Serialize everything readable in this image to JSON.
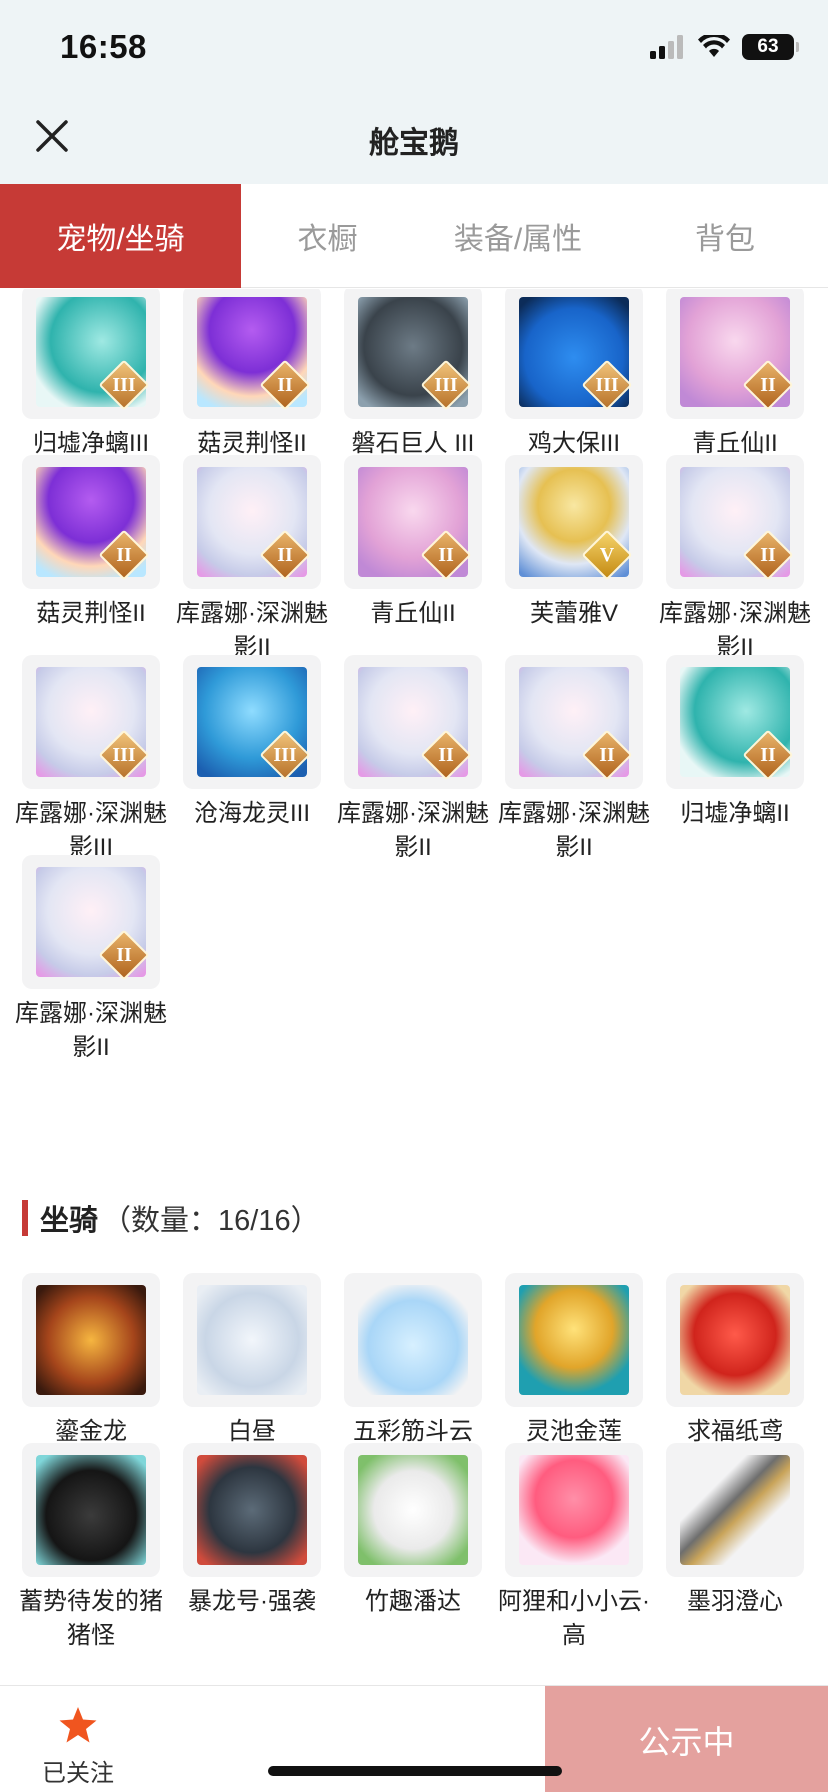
{
  "status": {
    "time": "16:58",
    "battery": "63"
  },
  "nav": {
    "title": "舱宝鹅"
  },
  "tabs": [
    {
      "label": "宠物/坐骑",
      "active": true
    },
    {
      "label": "衣橱",
      "active": false
    },
    {
      "label": "装备/属性",
      "active": false
    },
    {
      "label": "背包",
      "active": false
    }
  ],
  "pets": [
    {
      "name": "归墟净螭III",
      "rank": "III",
      "icon": "teal-dragon"
    },
    {
      "name": "菇灵荆怪II",
      "rank": "II",
      "icon": "purple-mushroom-child"
    },
    {
      "name": "磐石巨人 III",
      "rank": "III",
      "icon": "stone-golem"
    },
    {
      "name": "鸡大保III",
      "rank": "III",
      "icon": "blue-bird"
    },
    {
      "name": "青丘仙II",
      "rank": "II",
      "icon": "fox-fairy"
    },
    {
      "name": "菇灵荆怪II",
      "rank": "II",
      "icon": "purple-mushroom-child"
    },
    {
      "name": "库露娜·深渊魅影II",
      "rank": "II",
      "icon": "white-haired-spirit"
    },
    {
      "name": "青丘仙II",
      "rank": "II",
      "icon": "fox-fairy"
    },
    {
      "name": "芙蕾雅V",
      "rank": "V",
      "icon": "golden-valkyrie"
    },
    {
      "name": "库露娜·深渊魅影II",
      "rank": "II",
      "icon": "white-haired-spirit"
    },
    {
      "name": "库露娜·深渊魅影III",
      "rank": "III",
      "icon": "white-haired-spirit"
    },
    {
      "name": "沧海龙灵III",
      "rank": "III",
      "icon": "blue-dragon-boy"
    },
    {
      "name": "库露娜·深渊魅影II",
      "rank": "II",
      "icon": "white-haired-spirit"
    },
    {
      "name": "库露娜·深渊魅影II",
      "rank": "II",
      "icon": "white-haired-spirit"
    },
    {
      "name": "归墟净螭II",
      "rank": "II",
      "icon": "teal-dragon"
    },
    {
      "name": "库露娜·深渊魅影II",
      "rank": "II",
      "icon": "white-haired-spirit"
    }
  ],
  "mounts_section": {
    "title": "坐骑",
    "count": "（数量：16/16）"
  },
  "mounts": [
    {
      "name": "鎏金龙",
      "icon": "golden-dragon"
    },
    {
      "name": "白昼",
      "icon": "white-dragon"
    },
    {
      "name": "五彩筋斗云",
      "icon": "cloud"
    },
    {
      "name": "灵池金莲",
      "icon": "golden-lotus"
    },
    {
      "name": "求福纸鸢",
      "icon": "fish-kite"
    },
    {
      "name": "蓄势待发的猪猪怪",
      "icon": "black-pig"
    },
    {
      "name": "暴龙号·强袭",
      "icon": "mecha-dragon"
    },
    {
      "name": "竹趣潘达",
      "icon": "panda"
    },
    {
      "name": "阿狸和小小云·高",
      "icon": "ali-fox-cloud"
    },
    {
      "name": "墨羽澄心",
      "icon": "sword"
    }
  ],
  "bottom": {
    "follow_label": "已关注",
    "publish_label": "公示中"
  },
  "colors": {
    "accent": "#c63a36",
    "publish_bg": "#e4a19e",
    "follow_star": "#f0551f"
  }
}
